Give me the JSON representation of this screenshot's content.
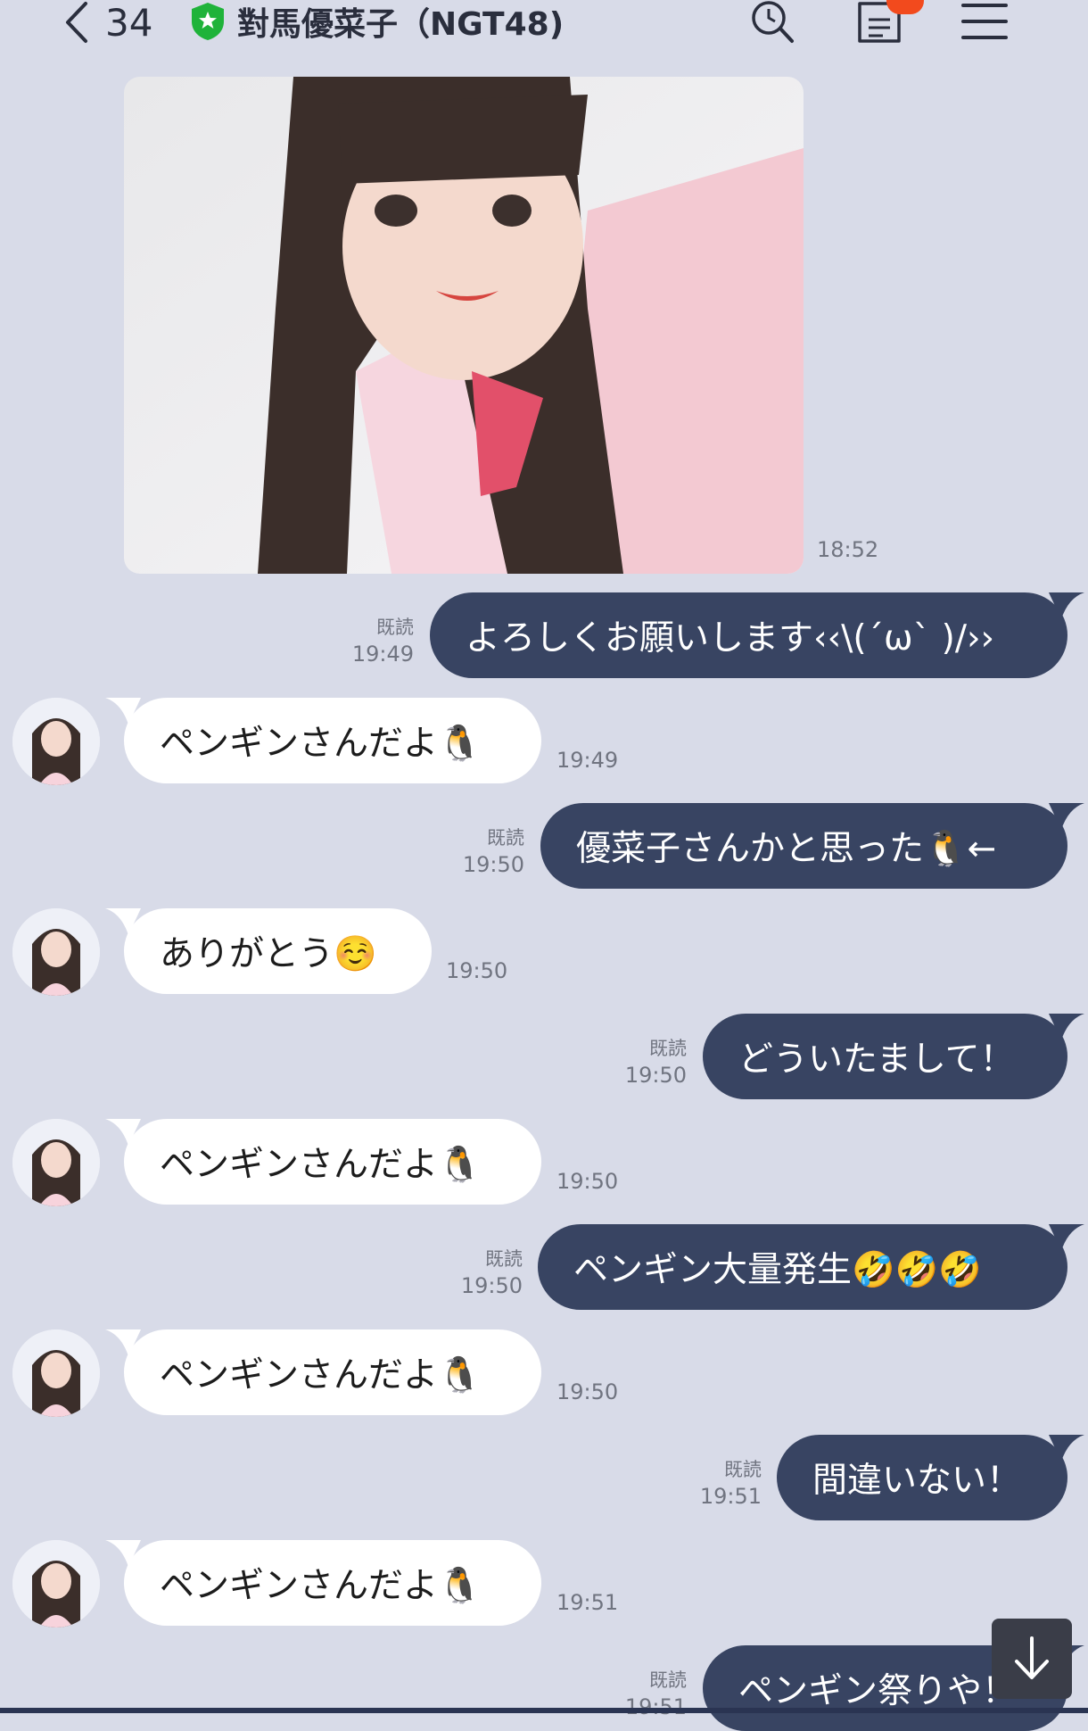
{
  "header": {
    "back_count": "34",
    "title": "對馬優菜子（NGT48)"
  },
  "messages": [
    {
      "id": "m0",
      "kind": "photo",
      "direction": "in",
      "time": "18:52"
    },
    {
      "id": "m1",
      "direction": "out",
      "text": "よろしくお願いします‹‹\\(´ω` )/››",
      "read": "既読",
      "time": "19:49"
    },
    {
      "id": "m2",
      "direction": "in",
      "text": "ペンギンさんだよ🐧",
      "time": "19:49"
    },
    {
      "id": "m3",
      "direction": "out",
      "text": "優菜子さんかと思った🐧←",
      "read": "既読",
      "time": "19:50"
    },
    {
      "id": "m4",
      "direction": "in",
      "text": "ありがとう☺️",
      "time": "19:50"
    },
    {
      "id": "m5",
      "direction": "out",
      "text": "どういたまして！",
      "read": "既読",
      "time": "19:50"
    },
    {
      "id": "m6",
      "direction": "in",
      "text": "ペンギンさんだよ🐧",
      "time": "19:50"
    },
    {
      "id": "m7",
      "direction": "out",
      "text": "ペンギン大量発生🤣🤣🤣",
      "read": "既読",
      "time": "19:50"
    },
    {
      "id": "m8",
      "direction": "in",
      "text": "ペンギンさんだよ🐧",
      "time": "19:50"
    },
    {
      "id": "m9",
      "direction": "out",
      "text": "間違いない！",
      "read": "既読",
      "time": "19:51"
    },
    {
      "id": "m10",
      "direction": "in",
      "text": "ペンギンさんだよ🐧",
      "time": "19:51"
    },
    {
      "id": "m11",
      "direction": "out",
      "text": "ペンギン祭りや！",
      "read": "既読",
      "time": "19:51"
    }
  ],
  "icons": {
    "back": "chevron-left-icon",
    "official": "shield-star-icon",
    "search": "search-icon",
    "notes": "note-icon",
    "menu": "hamburger-menu-icon",
    "scroll": "arrow-down-icon"
  },
  "colors": {
    "background": "#d8dbe8",
    "outgoing_bubble": "#384462",
    "incoming_bubble": "#ffffff",
    "official_green": "#1fb33a",
    "badge": "#f24a1d"
  }
}
